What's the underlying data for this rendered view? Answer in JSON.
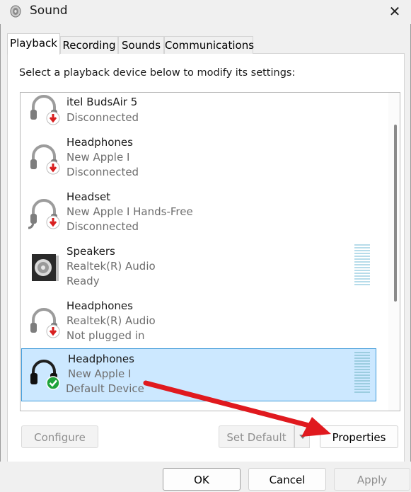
{
  "window": {
    "title": "Sound"
  },
  "tabs": [
    {
      "label": "Playback",
      "active": true
    },
    {
      "label": "Recording",
      "active": false
    },
    {
      "label": "Sounds",
      "active": false
    },
    {
      "label": "Communications",
      "active": false
    }
  ],
  "instruction": "Select a playback device below to modify its settings:",
  "devices": [
    {
      "name": "itel BudsAir 5",
      "description": "",
      "status": "Disconnected",
      "icon": "headphones-disconnected-icon"
    },
    {
      "name": "Headphones",
      "description": "New Apple I",
      "status": "Disconnected",
      "icon": "headphones-disconnected-icon"
    },
    {
      "name": "Headset",
      "description": "New Apple I Hands-Free",
      "status": "Disconnected",
      "icon": "headset-disconnected-icon"
    },
    {
      "name": "Speakers",
      "description": "Realtek(R) Audio",
      "status": "Ready",
      "icon": "speaker-icon"
    },
    {
      "name": "Headphones",
      "description": "Realtek(R) Audio",
      "status": "Not plugged in",
      "icon": "headphones-unplugged-icon"
    },
    {
      "name": "Headphones",
      "description": "New Apple I",
      "status": "Default Device",
      "icon": "headphones-default-icon",
      "selected": true
    }
  ],
  "buttons": {
    "configure": "Configure",
    "set_default": "Set Default",
    "properties": "Properties",
    "ok": "OK",
    "cancel": "Cancel",
    "apply": "Apply"
  },
  "colors": {
    "selection_bg": "#cce8ff",
    "selection_border": "#3f9ad9",
    "arrow": "#e0191e",
    "default_check": "#1fa33b",
    "disconnected_badge": "#d81e1e"
  }
}
